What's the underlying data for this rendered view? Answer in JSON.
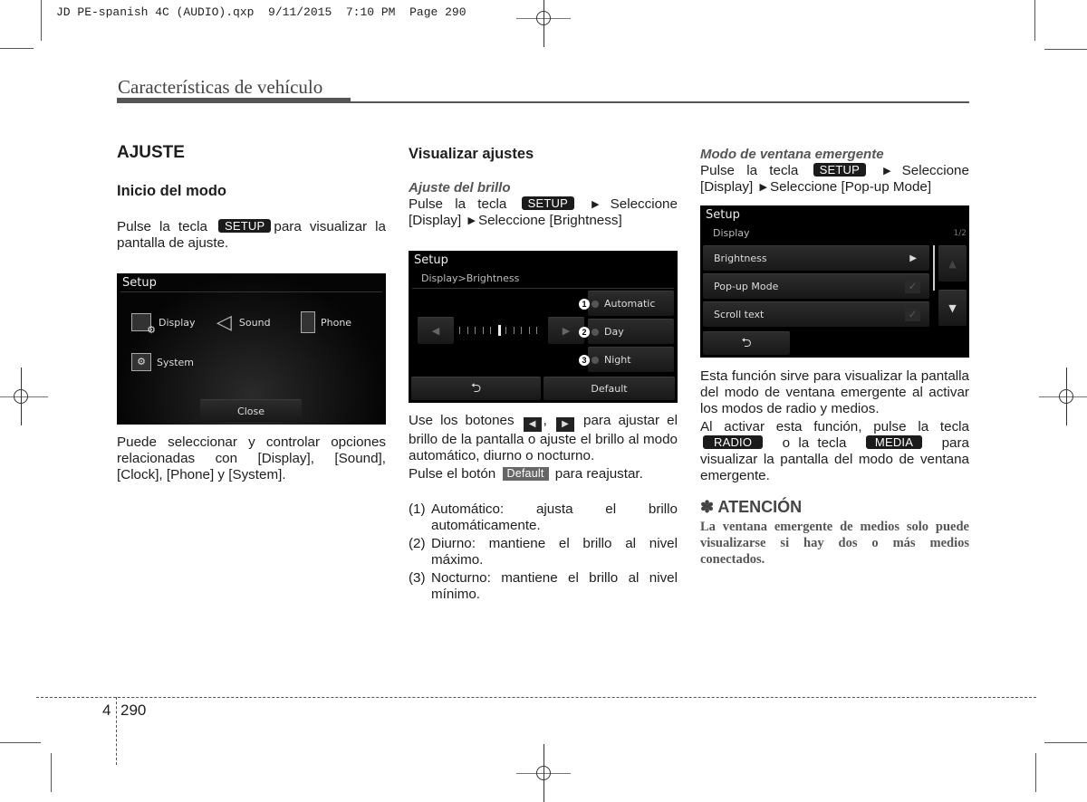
{
  "slug": {
    "filename": "JD PE-spanish 4C (AUDIO).qxp",
    "date": "9/11/2015",
    "time": "7:10 PM",
    "page_label": "Page 290"
  },
  "header": {
    "section_title": "Características de vehículo"
  },
  "col1": {
    "heading": "AJUSTE",
    "subheading": "Inicio del modo",
    "para1_before": "Pulse la tecla",
    "para1_key": "SETUP",
    "para1_after": "para visualizar la pantalla de ajuste.",
    "screen": {
      "title": "Setup",
      "items": [
        {
          "label": "Display",
          "icon": "display-icon"
        },
        {
          "label": "Sound",
          "icon": "speaker-icon"
        },
        {
          "label": "Phone",
          "icon": "phone-icon"
        },
        {
          "label": "System",
          "icon": "system-icon"
        }
      ],
      "close_label": "Close"
    },
    "para2": "Puede seleccionar y controlar opciones relacionadas con [Display], [Sound], [Clock], [Phone] y [System]."
  },
  "col2": {
    "heading": "Visualizar ajustes",
    "subheading": "Ajuste del brillo",
    "para1_before": "Pulse la tecla",
    "para1_key": "SETUP",
    "para1_mid": "Seleccione [Display]",
    "para1_after": "Seleccione [Brightness]",
    "screen": {
      "title": "Setup",
      "breadcrumb": "Display>Brightness",
      "options": [
        {
          "num": "1",
          "label": "Automatic"
        },
        {
          "num": "2",
          "label": "Day"
        },
        {
          "num": "3",
          "label": "Night"
        }
      ],
      "slider_level": 0.55,
      "slider_ticks": 11,
      "back_icon": "back-arrow-icon",
      "default_label": "Default"
    },
    "para2_before": "Use los botones",
    "para2_sep": ",",
    "para2_after": "para ajustar el brillo de la pantalla o ajuste el brillo al modo automático, diurno o nocturno.",
    "para3_before": "Pulse el botón",
    "para3_key": "Default",
    "para3_after": "para reajustar.",
    "list": [
      {
        "num": "(1)",
        "text": "Automático: ajusta el brillo automáticamente."
      },
      {
        "num": "(2)",
        "text": "Diurno: mantiene el brillo al nivel máximo."
      },
      {
        "num": "(3)",
        "text": "Nocturno: mantiene el brillo al nivel mínimo."
      }
    ]
  },
  "col3": {
    "subheading": "Modo de ventana emergente",
    "para1_before": "Pulse la tecla",
    "para1_key": "SETUP",
    "para1_mid": "Seleccione [Display]",
    "para1_after": "Seleccione [Pop-up Mode]",
    "screen": {
      "title": "Setup",
      "breadcrumb": "Display",
      "page_indicator": "1/2",
      "rows": [
        {
          "label": "Brightness",
          "control": "arrow"
        },
        {
          "label": "Pop-up Mode",
          "control": "check"
        },
        {
          "label": "Scroll text",
          "control": "check"
        }
      ]
    },
    "para2": "Esta función sirve para visualizar la pantalla del modo de ventana emergente al activar los modos de radio y medios.",
    "para3_before": "Al activar esta función, pulse la tecla",
    "para3_key1": "RADIO",
    "para3_mid": "o la tecla",
    "para3_key2": "MEDIA",
    "para3_after": "para visualizar la pantalla del modo de ventana emergente.",
    "notice_title": "✽ ATENCIÓN",
    "notice_text": "La ventana emergente de medios solo puede visualizarse si hay dos o más medios conectados."
  },
  "footer": {
    "chapter": "4",
    "page": "290"
  }
}
